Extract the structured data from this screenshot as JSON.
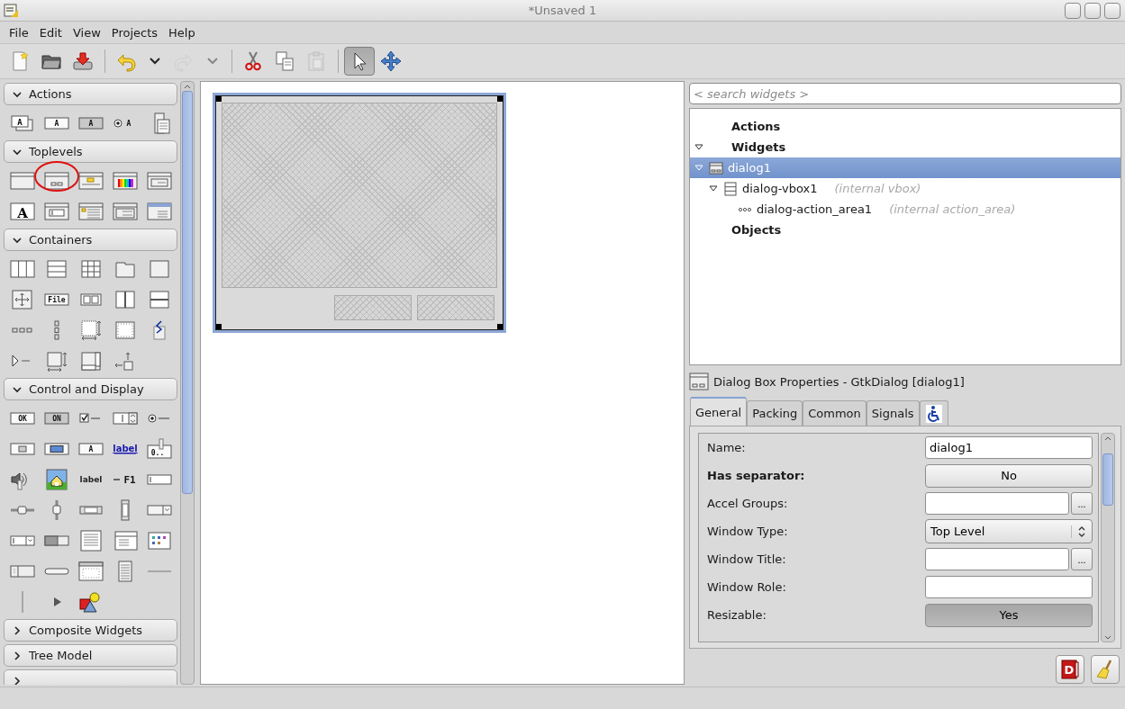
{
  "window": {
    "title": "*Unsaved 1"
  },
  "menu": [
    {
      "label": "File"
    },
    {
      "label": "Edit"
    },
    {
      "label": "View"
    },
    {
      "label": "Projects"
    },
    {
      "label": "Help"
    }
  ],
  "toolbar": [
    {
      "kind": "new",
      "disabled": false,
      "pressed": false
    },
    {
      "kind": "open",
      "disabled": false,
      "pressed": false
    },
    {
      "kind": "save",
      "disabled": false,
      "pressed": false
    },
    {
      "kind": "separator"
    },
    {
      "kind": "undo",
      "disabled": false,
      "pressed": false
    },
    {
      "kind": "dropdown",
      "disabled": false,
      "pressed": false
    },
    {
      "kind": "redo",
      "disabled": true,
      "pressed": false
    },
    {
      "kind": "dropdown",
      "disabled": true,
      "pressed": false
    },
    {
      "kind": "separator"
    },
    {
      "kind": "cut",
      "disabled": false,
      "pressed": false
    },
    {
      "kind": "copy",
      "disabled": false,
      "pressed": false
    },
    {
      "kind": "paste",
      "disabled": true,
      "pressed": false
    },
    {
      "kind": "separator"
    },
    {
      "kind": "pointer",
      "disabled": false,
      "pressed": true
    },
    {
      "kind": "drag",
      "disabled": false,
      "pressed": false
    }
  ],
  "palette": {
    "sections": [
      {
        "title": "Actions",
        "expanded": true,
        "items": [
          {
            "kind": "boxed-stack",
            "text": "A",
            "circled": false
          },
          {
            "kind": "boxed",
            "text": "A",
            "circled": false
          },
          {
            "kind": "boxed-dark",
            "text": "A",
            "circled": false
          },
          {
            "kind": "radio",
            "text": "A",
            "circled": false
          },
          {
            "kind": "doc-stack",
            "circled": false
          }
        ]
      },
      {
        "title": "Toplevels",
        "expanded": true,
        "items": [
          {
            "kind": "window",
            "circled": false
          },
          {
            "kind": "dialog",
            "circled": true
          },
          {
            "kind": "about",
            "circled": false
          },
          {
            "kind": "colorsel",
            "circled": false
          },
          {
            "kind": "window-form",
            "circled": false
          },
          {
            "kind": "fontsel",
            "text": "A",
            "circled": false
          },
          {
            "kind": "window-entry",
            "circled": false
          },
          {
            "kind": "window-message",
            "circled": false
          },
          {
            "kind": "window-list",
            "circled": false
          },
          {
            "kind": "window-assistant",
            "circled": false
          }
        ]
      },
      {
        "title": "Containers",
        "expanded": true,
        "items": [
          {
            "kind": "cols",
            "circled": false
          },
          {
            "kind": "rows",
            "circled": false
          },
          {
            "kind": "grid",
            "circled": false
          },
          {
            "kind": "notebook",
            "circled": false
          },
          {
            "kind": "frame",
            "circled": false
          },
          {
            "kind": "move",
            "circled": false
          },
          {
            "kind": "boxed",
            "text": "File",
            "circled": false
          },
          {
            "kind": "pair",
            "circled": false
          },
          {
            "kind": "hpane",
            "circled": false
          },
          {
            "kind": "vpane",
            "circled": false
          },
          {
            "kind": "dots-h",
            "circled": false
          },
          {
            "kind": "dots-v",
            "circled": false
          },
          {
            "kind": "layout",
            "circled": false
          },
          {
            "kind": "dotted",
            "circled": false
          },
          {
            "kind": "zigzag",
            "circled": false
          },
          {
            "kind": "expander",
            "circled": false
          },
          {
            "kind": "aspect",
            "circled": false
          },
          {
            "kind": "scrolled",
            "circled": false
          },
          {
            "kind": "corner-arrow",
            "circled": false
          }
        ]
      },
      {
        "title": "Control and Display",
        "expanded": true,
        "items": [
          {
            "kind": "boxed",
            "text": "OK",
            "circled": false
          },
          {
            "kind": "boxed-dark",
            "text": "ON",
            "circled": false
          },
          {
            "kind": "check",
            "circled": false
          },
          {
            "kind": "spin",
            "circled": false
          },
          {
            "kind": "radio-dash",
            "circled": false
          },
          {
            "kind": "folder-button",
            "circled": false
          },
          {
            "kind": "color-button",
            "circled": false
          },
          {
            "kind": "boxed",
            "text": "A",
            "circled": false
          },
          {
            "kind": "link",
            "text": "label",
            "circled": false
          },
          {
            "kind": "scale-button",
            "text": "0..",
            "circled": false
          },
          {
            "kind": "volume",
            "circled": false
          },
          {
            "kind": "image",
            "circled": false
          },
          {
            "kind": "label",
            "text": "label",
            "circled": false
          },
          {
            "kind": "accel",
            "text": "F1",
            "circled": false
          },
          {
            "kind": "entry",
            "circled": false
          },
          {
            "kind": "hscale",
            "circled": false
          },
          {
            "kind": "vscale",
            "circled": false
          },
          {
            "kind": "hscroll",
            "circled": false
          },
          {
            "kind": "vscroll",
            "circled": false
          },
          {
            "kind": "combo",
            "circled": false
          },
          {
            "kind": "combo-entry",
            "circled": false
          },
          {
            "kind": "progress",
            "circled": false
          },
          {
            "kind": "textview",
            "circled": false
          },
          {
            "kind": "treeview",
            "circled": false
          },
          {
            "kind": "iconview",
            "circled": false
          },
          {
            "kind": "statusbar",
            "circled": false
          },
          {
            "kind": "bar",
            "circled": false
          },
          {
            "kind": "calendar",
            "circled": false
          },
          {
            "kind": "doc",
            "circled": false
          },
          {
            "kind": "hsep",
            "circled": false
          },
          {
            "kind": "vsep",
            "circled": false
          },
          {
            "kind": "arrow",
            "circled": false
          },
          {
            "kind": "shapes",
            "circled": false
          }
        ]
      },
      {
        "title": "Composite Widgets",
        "expanded": false
      },
      {
        "title": "Tree Model",
        "expanded": false
      },
      {
        "expanded": false
      }
    ]
  },
  "inspector": {
    "search": {
      "placeholder": "< search widgets >"
    },
    "tree": [
      {
        "label": "Actions",
        "kind": "category"
      },
      {
        "label": "Widgets",
        "kind": "category",
        "expanded": true,
        "selected": false,
        "children": [
          {
            "label": "dialog1",
            "kind": "dialog",
            "expanded": true,
            "selected": true,
            "children": [
              {
                "label": "dialog-vbox1",
                "kind": "vbox",
                "note": "(internal vbox)",
                "expanded": true,
                "selected": false,
                "children": [
                  {
                    "label": "dialog-action_area1",
                    "kind": "button-box",
                    "note": "(internal action_area)",
                    "selected": false
                  }
                ]
              }
            ]
          }
        ]
      },
      {
        "label": "Objects",
        "kind": "category"
      }
    ]
  },
  "properties": {
    "title": "Dialog Box Properties - GtkDialog [dialog1]",
    "tabs": [
      {
        "label": "General",
        "selected": true
      },
      {
        "label": "Packing",
        "selected": false
      },
      {
        "label": "Common",
        "selected": false
      },
      {
        "label": "Signals",
        "selected": false
      },
      {
        "kind": "accessibility",
        "selected": false
      }
    ],
    "rows": [
      {
        "label": "Name:",
        "modified": false,
        "kind": "entry",
        "value": "dialog1"
      },
      {
        "label": "Has separator:",
        "modified": true,
        "kind": "toggle",
        "value": "No",
        "pressed": false
      },
      {
        "label": "Accel Groups:",
        "modified": false,
        "kind": "entry-button",
        "button": "..."
      },
      {
        "label": "Window Type:",
        "modified": false,
        "kind": "combo",
        "value": "Top Level"
      },
      {
        "label": "Window Title:",
        "modified": false,
        "kind": "entry-button",
        "button": "..."
      },
      {
        "label": "Window Role:",
        "modified": false,
        "kind": "entry"
      },
      {
        "label": "Resizable:",
        "modified": false,
        "kind": "toggle",
        "value": "Yes",
        "pressed": true
      }
    ]
  },
  "bottom_buttons": [
    {
      "kind": "help-book",
      "text": "D"
    },
    {
      "kind": "broom"
    }
  ]
}
